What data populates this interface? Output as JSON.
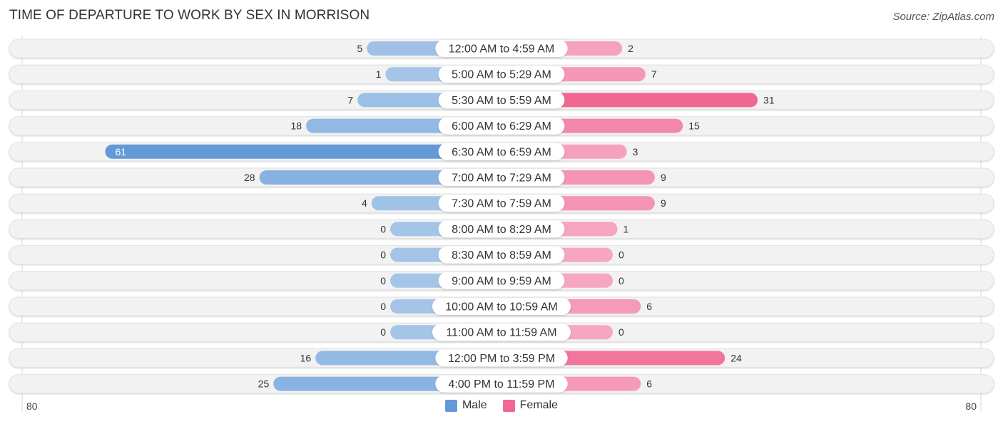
{
  "title": "TIME OF DEPARTURE TO WORK BY SEX IN MORRISON",
  "source": "Source: ZipAtlas.com",
  "colors": {
    "male_strong": "#6399d9",
    "male_light": "#a5c5e8",
    "female_strong": "#f06892",
    "female_light": "#f7a6c0",
    "row_bg": "#f2f2f2"
  },
  "legend": [
    {
      "label": "Male",
      "color": "#6399d9"
    },
    {
      "label": "Female",
      "color": "#f06892"
    }
  ],
  "axis": {
    "left_label": "80",
    "right_label": "80"
  },
  "chart_data": {
    "type": "bar",
    "orientation": "horizontal-diverging",
    "title": "TIME OF DEPARTURE TO WORK BY SEX IN MORRISON",
    "categories": [
      "12:00 AM to 4:59 AM",
      "5:00 AM to 5:29 AM",
      "5:30 AM to 5:59 AM",
      "6:00 AM to 6:29 AM",
      "6:30 AM to 6:59 AM",
      "7:00 AM to 7:29 AM",
      "7:30 AM to 7:59 AM",
      "8:00 AM to 8:29 AM",
      "8:30 AM to 8:59 AM",
      "9:00 AM to 9:59 AM",
      "10:00 AM to 10:59 AM",
      "11:00 AM to 11:59 AM",
      "12:00 PM to 3:59 PM",
      "4:00 PM to 11:59 PM"
    ],
    "series": [
      {
        "name": "Male",
        "values": [
          5,
          1,
          7,
          18,
          61,
          28,
          4,
          0,
          0,
          0,
          0,
          0,
          16,
          25
        ]
      },
      {
        "name": "Female",
        "values": [
          2,
          7,
          31,
          15,
          3,
          9,
          9,
          1,
          0,
          0,
          6,
          0,
          24,
          6
        ]
      }
    ],
    "xlim": [
      -80,
      80
    ],
    "legend_position": "bottom-center",
    "xlabel": "",
    "ylabel": ""
  }
}
